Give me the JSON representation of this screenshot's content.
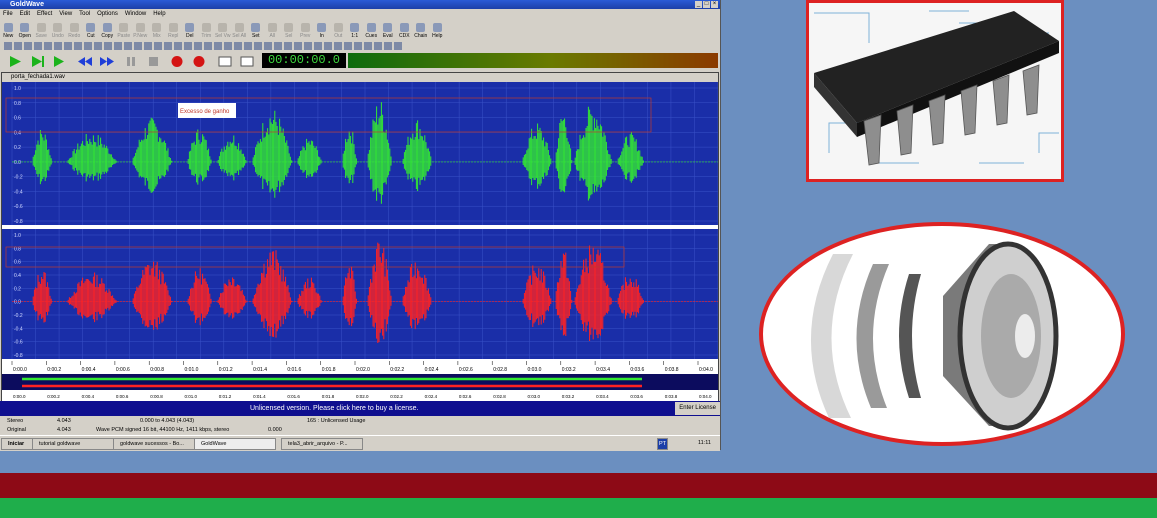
{
  "app": {
    "title": "GoldWave",
    "menu": [
      "File",
      "Edit",
      "Effect",
      "View",
      "Tool",
      "Options",
      "Window",
      "Help"
    ],
    "toolbar": [
      "New",
      "Open",
      "Save",
      "Undo",
      "Redo",
      "Cut",
      "Copy",
      "Paste",
      "P.New",
      "Mix",
      "Repl",
      "Del",
      "Trim",
      "Sel Vw",
      "Sel All",
      "Set",
      "All",
      "Sel",
      "Prev",
      "In",
      "Out",
      "1:1",
      "Cues",
      "Eval",
      "CDX",
      "Chain",
      "Help"
    ],
    "toolbar_enabled": [
      true,
      true,
      false,
      false,
      false,
      true,
      true,
      false,
      false,
      false,
      false,
      true,
      false,
      false,
      false,
      true,
      false,
      false,
      false,
      true,
      false,
      true,
      true,
      true,
      true,
      true,
      true
    ],
    "time_display": "00:00:00.0",
    "document": {
      "title": "porta_fechada1.wav",
      "annotation": "Excesso de ganho",
      "y_labels": [
        "1.0",
        "0.8",
        "0.6",
        "0.4",
        "0.2",
        "0.0",
        "-0.2",
        "-0.4",
        "-0.6",
        "-0.8"
      ],
      "time_labels": [
        "0.0",
        "0.2",
        "0.4",
        "0.6",
        "0.8",
        "1.0",
        "1.2",
        "1.4",
        "1.6",
        "1.8",
        "2.0",
        "2.2",
        "2.4",
        "2.6",
        "2.8",
        "3.0",
        "3.2",
        "3.4",
        "3.6",
        "3.8",
        "4.0"
      ]
    },
    "banner": "Unlicensed version. Please click here to buy a license.",
    "enter_license": "Enter License",
    "status": {
      "row1": [
        "Stereo",
        "4.043",
        "0.000 to 4.043 (4.043)",
        "165 : Unlicensed Usage"
      ],
      "row2": [
        "Original",
        "4.043",
        "Wave PCM signed 16 bit, 44100 Hz, 1411 kbps, stereo",
        "0.000"
      ]
    },
    "taskbar": {
      "start": "Iniciar",
      "tasks": [
        "tutorial goldwave",
        "goldwave sucessos - Bo...",
        "GoldWave",
        "tela3_abrir_arquivo - P..."
      ],
      "lang": "PT",
      "clock": "11:11"
    }
  },
  "colors": {
    "left_channel": "#33e833",
    "right_channel": "#ff2222",
    "wave_bg": "#1a2ea8",
    "border": "#dd2222",
    "stripe_red": "#8d0a16",
    "stripe_green": "#1fae4b"
  },
  "icons": [
    "chip-icon",
    "speaker-icon"
  ]
}
